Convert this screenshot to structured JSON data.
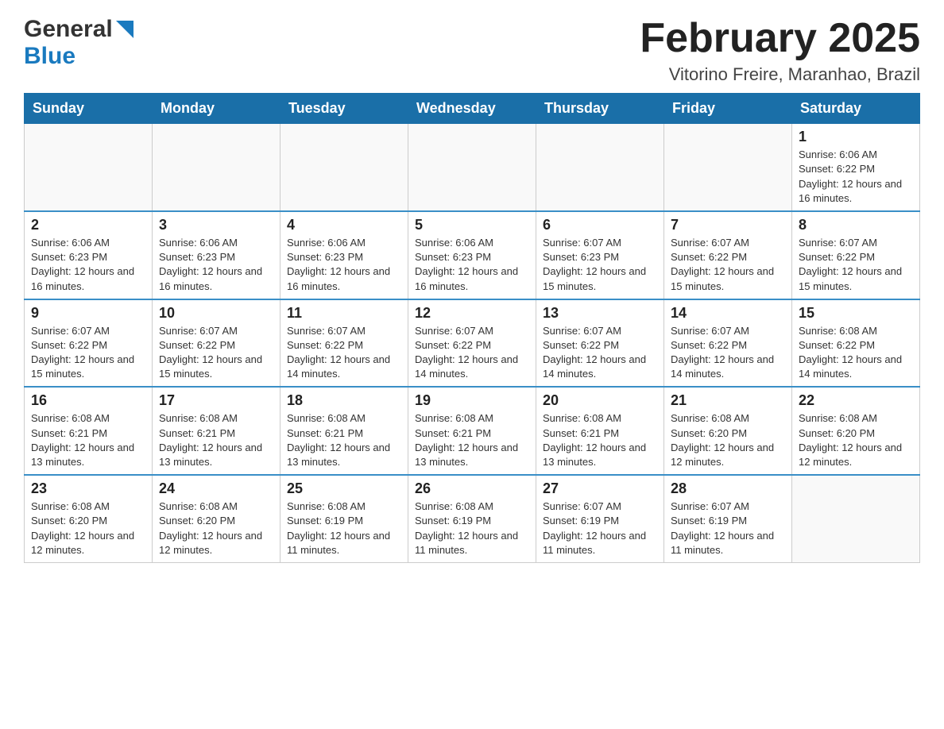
{
  "header": {
    "logo_line1": "General",
    "logo_line2": "Blue",
    "month_title": "February 2025",
    "subtitle": "Vitorino Freire, Maranhao, Brazil"
  },
  "calendar": {
    "days_of_week": [
      "Sunday",
      "Monday",
      "Tuesday",
      "Wednesday",
      "Thursday",
      "Friday",
      "Saturday"
    ],
    "weeks": [
      [
        {
          "day": "",
          "info": ""
        },
        {
          "day": "",
          "info": ""
        },
        {
          "day": "",
          "info": ""
        },
        {
          "day": "",
          "info": ""
        },
        {
          "day": "",
          "info": ""
        },
        {
          "day": "",
          "info": ""
        },
        {
          "day": "1",
          "info": "Sunrise: 6:06 AM\nSunset: 6:22 PM\nDaylight: 12 hours and 16 minutes."
        }
      ],
      [
        {
          "day": "2",
          "info": "Sunrise: 6:06 AM\nSunset: 6:23 PM\nDaylight: 12 hours and 16 minutes."
        },
        {
          "day": "3",
          "info": "Sunrise: 6:06 AM\nSunset: 6:23 PM\nDaylight: 12 hours and 16 minutes."
        },
        {
          "day": "4",
          "info": "Sunrise: 6:06 AM\nSunset: 6:23 PM\nDaylight: 12 hours and 16 minutes."
        },
        {
          "day": "5",
          "info": "Sunrise: 6:06 AM\nSunset: 6:23 PM\nDaylight: 12 hours and 16 minutes."
        },
        {
          "day": "6",
          "info": "Sunrise: 6:07 AM\nSunset: 6:23 PM\nDaylight: 12 hours and 15 minutes."
        },
        {
          "day": "7",
          "info": "Sunrise: 6:07 AM\nSunset: 6:22 PM\nDaylight: 12 hours and 15 minutes."
        },
        {
          "day": "8",
          "info": "Sunrise: 6:07 AM\nSunset: 6:22 PM\nDaylight: 12 hours and 15 minutes."
        }
      ],
      [
        {
          "day": "9",
          "info": "Sunrise: 6:07 AM\nSunset: 6:22 PM\nDaylight: 12 hours and 15 minutes."
        },
        {
          "day": "10",
          "info": "Sunrise: 6:07 AM\nSunset: 6:22 PM\nDaylight: 12 hours and 15 minutes."
        },
        {
          "day": "11",
          "info": "Sunrise: 6:07 AM\nSunset: 6:22 PM\nDaylight: 12 hours and 14 minutes."
        },
        {
          "day": "12",
          "info": "Sunrise: 6:07 AM\nSunset: 6:22 PM\nDaylight: 12 hours and 14 minutes."
        },
        {
          "day": "13",
          "info": "Sunrise: 6:07 AM\nSunset: 6:22 PM\nDaylight: 12 hours and 14 minutes."
        },
        {
          "day": "14",
          "info": "Sunrise: 6:07 AM\nSunset: 6:22 PM\nDaylight: 12 hours and 14 minutes."
        },
        {
          "day": "15",
          "info": "Sunrise: 6:08 AM\nSunset: 6:22 PM\nDaylight: 12 hours and 14 minutes."
        }
      ],
      [
        {
          "day": "16",
          "info": "Sunrise: 6:08 AM\nSunset: 6:21 PM\nDaylight: 12 hours and 13 minutes."
        },
        {
          "day": "17",
          "info": "Sunrise: 6:08 AM\nSunset: 6:21 PM\nDaylight: 12 hours and 13 minutes."
        },
        {
          "day": "18",
          "info": "Sunrise: 6:08 AM\nSunset: 6:21 PM\nDaylight: 12 hours and 13 minutes."
        },
        {
          "day": "19",
          "info": "Sunrise: 6:08 AM\nSunset: 6:21 PM\nDaylight: 12 hours and 13 minutes."
        },
        {
          "day": "20",
          "info": "Sunrise: 6:08 AM\nSunset: 6:21 PM\nDaylight: 12 hours and 13 minutes."
        },
        {
          "day": "21",
          "info": "Sunrise: 6:08 AM\nSunset: 6:20 PM\nDaylight: 12 hours and 12 minutes."
        },
        {
          "day": "22",
          "info": "Sunrise: 6:08 AM\nSunset: 6:20 PM\nDaylight: 12 hours and 12 minutes."
        }
      ],
      [
        {
          "day": "23",
          "info": "Sunrise: 6:08 AM\nSunset: 6:20 PM\nDaylight: 12 hours and 12 minutes."
        },
        {
          "day": "24",
          "info": "Sunrise: 6:08 AM\nSunset: 6:20 PM\nDaylight: 12 hours and 12 minutes."
        },
        {
          "day": "25",
          "info": "Sunrise: 6:08 AM\nSunset: 6:19 PM\nDaylight: 12 hours and 11 minutes."
        },
        {
          "day": "26",
          "info": "Sunrise: 6:08 AM\nSunset: 6:19 PM\nDaylight: 12 hours and 11 minutes."
        },
        {
          "day": "27",
          "info": "Sunrise: 6:07 AM\nSunset: 6:19 PM\nDaylight: 12 hours and 11 minutes."
        },
        {
          "day": "28",
          "info": "Sunrise: 6:07 AM\nSunset: 6:19 PM\nDaylight: 12 hours and 11 minutes."
        },
        {
          "day": "",
          "info": ""
        }
      ]
    ]
  }
}
